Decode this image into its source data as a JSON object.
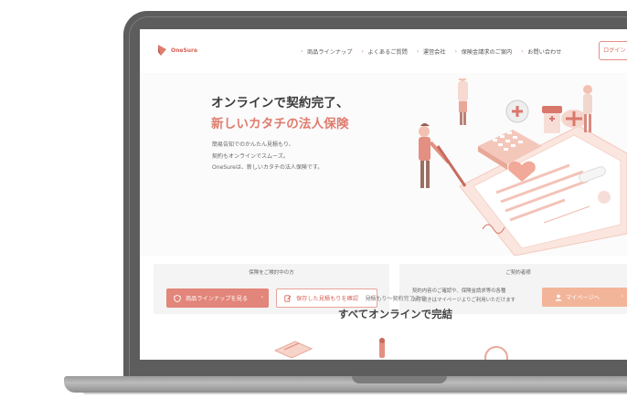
{
  "brand": {
    "logo_text": "OneSure",
    "accent": "#e07b6d",
    "accent_light": "#f2b59a"
  },
  "nav": {
    "items": [
      "商品ラインナップ",
      "よくあるご質問",
      "運営会社",
      "保険金請求のご案内",
      "お問い合わせ"
    ],
    "login_label": "ログイン"
  },
  "hero": {
    "title_line1": "オンラインで契約完了、",
    "title_line2": "新しいカタチの法人保険",
    "desc": [
      "簡易告知でのかんたん見積もり、",
      "契約もオンラインでスムーズ。",
      "OneSureは、新しいカタチの法人保険です。"
    ]
  },
  "panel_left": {
    "title": "保険をご検討中の方",
    "primary_button": "商品ラインナップを見る",
    "secondary_button": "保存した見積もりを確認"
  },
  "panel_right": {
    "title": "ご契約者様",
    "desc": [
      "契約内容のご確認や、保険金請求等の各種",
      "お手続きはマイページよりご利用いただけます"
    ],
    "button": "マイページへ"
  },
  "section": {
    "subtitle": "見積もり〜契約完了まで",
    "title": "すべてオンラインで完結"
  }
}
